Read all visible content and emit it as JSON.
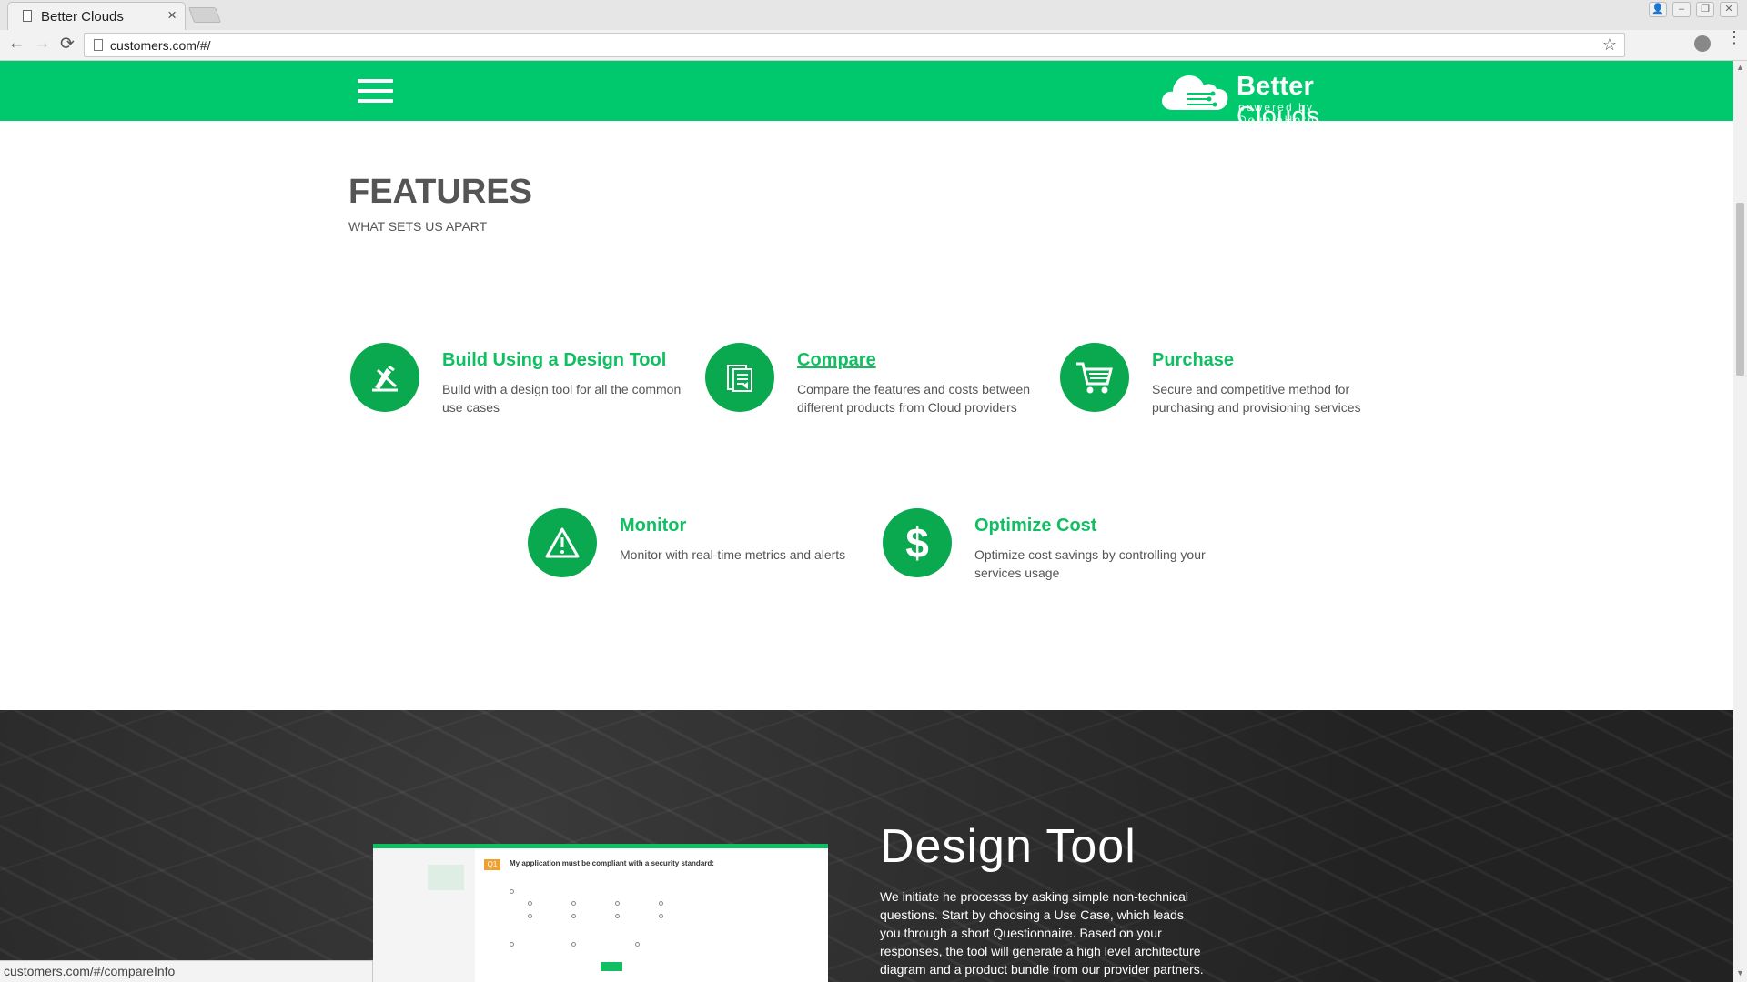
{
  "browser": {
    "tab_title": "Better Clouds",
    "tab_close": "×",
    "url": "customers.com/#/",
    "back": "←",
    "forward": "→",
    "reload": "⟳",
    "star": "☆",
    "menu": "⋮",
    "status_url": "customers.com/#/compareInfo"
  },
  "header": {
    "logo_word1": "Better",
    "logo_word2": "Clouds",
    "logo_tagline": "powered by DoubleHorn"
  },
  "features": {
    "title": "FEATURES",
    "subtitle": "WHAT SETS US APART",
    "items": [
      {
        "title": "Build Using a Design Tool",
        "desc": "Build with a design tool for all the common use cases",
        "icon": "design-tool-icon"
      },
      {
        "title": "Compare",
        "desc": "Compare the features and costs between different products from Cloud providers",
        "icon": "compare-icon"
      },
      {
        "title": "Purchase",
        "desc": "Secure and competitive method for purchasing and provisioning services",
        "icon": "cart-icon"
      },
      {
        "title": "Monitor",
        "desc": "Monitor with real-time metrics and alerts",
        "icon": "warning-icon"
      },
      {
        "title": "Optimize Cost",
        "desc": "Optimize cost savings by controlling your services usage",
        "icon": "dollar-icon"
      }
    ]
  },
  "design_tool": {
    "title": "Design Tool",
    "text": "We initiate he processs by asking simple non-technical questions. Start by choosing a Use Case, which leads you through a short Questionnaire. Based on your responses, the tool will generate a high level architecture diagram and a product bundle from our provider partners.",
    "preview": {
      "question_num": "Q1",
      "question": "My application must be compliant with a security standard:"
    }
  },
  "colors": {
    "brand_green": "#00c96d",
    "icon_green": "#0aa84f",
    "title_green": "#0fbf62"
  }
}
